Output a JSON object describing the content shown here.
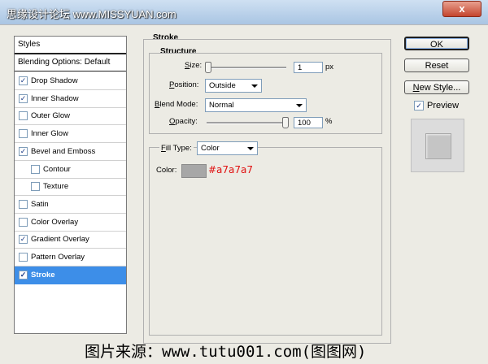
{
  "window": {
    "watermark": "思缘设计论坛 www.MISSYUAN.com",
    "close_glyph": "x"
  },
  "styles_panel": {
    "header": "Styles",
    "blending": "Blending Options: Default",
    "items": [
      {
        "label": "Drop Shadow",
        "checked": true,
        "sub": false,
        "selected": false
      },
      {
        "label": "Inner Shadow",
        "checked": true,
        "sub": false,
        "selected": false
      },
      {
        "label": "Outer Glow",
        "checked": false,
        "sub": false,
        "selected": false
      },
      {
        "label": "Inner Glow",
        "checked": false,
        "sub": false,
        "selected": false
      },
      {
        "label": "Bevel and Emboss",
        "checked": true,
        "sub": false,
        "selected": false
      },
      {
        "label": "Contour",
        "checked": false,
        "sub": true,
        "selected": false
      },
      {
        "label": "Texture",
        "checked": false,
        "sub": true,
        "selected": false
      },
      {
        "label": "Satin",
        "checked": false,
        "sub": false,
        "selected": false
      },
      {
        "label": "Color Overlay",
        "checked": false,
        "sub": false,
        "selected": false
      },
      {
        "label": "Gradient Overlay",
        "checked": true,
        "sub": false,
        "selected": false
      },
      {
        "label": "Pattern Overlay",
        "checked": false,
        "sub": false,
        "selected": false
      },
      {
        "label": "Stroke",
        "checked": true,
        "sub": false,
        "selected": true
      }
    ]
  },
  "stroke": {
    "title": "Stroke",
    "structure_title": "Structure",
    "size_label": "Size:",
    "size_value": "1",
    "size_unit": "px",
    "size_fraction": 0.0,
    "position_label": "Position:",
    "position_value": "Outside",
    "blend_label": "Blend Mode:",
    "blend_value": "Normal",
    "opacity_label": "Opacity:",
    "opacity_value": "100",
    "opacity_unit": "%",
    "opacity_fraction": 1.0,
    "fill_type_label": "Fill Type:",
    "fill_type_value": "Color",
    "color_label": "Color:",
    "color_hex": "#a7a7a7",
    "color_swatch": "#a7a7a7",
    "color_text_color": "#e01010"
  },
  "buttons": {
    "ok": "OK",
    "reset": "Reset",
    "new_style": "New Style...",
    "preview_label": "Preview",
    "preview_checked": true
  },
  "caption": "图片来源：www.tutu001.com(图图网)"
}
